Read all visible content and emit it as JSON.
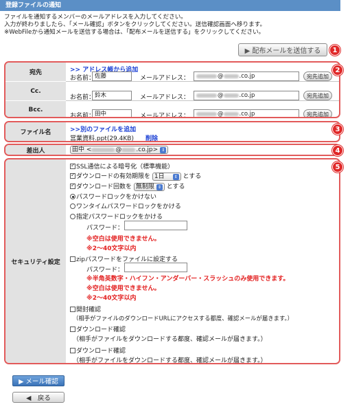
{
  "header": {
    "title": "登録ファイルの通知"
  },
  "intro": {
    "line1": "ファイルを通知するメンバーのメールアドレスを入力してください。",
    "line2": "入力が終わりましたら、「メール確認」ボタンをクリックしてください。送信確認画面へ移ります。",
    "line3": "※WebFileから通知メールを送信する場合は、「配布メールを送信する」をクリックしてください。"
  },
  "send_button": {
    "label": "▶ 配布メールを送信する"
  },
  "badges": [
    "1",
    "2",
    "3",
    "4",
    "5"
  ],
  "recipients": {
    "add_from_address_book": ">> アドレス帳から追加",
    "name_label": "お名前：",
    "mail_label": "メールアドレス：",
    "add_label": "宛先追加",
    "rows": [
      {
        "label": "宛先",
        "name": "佐藤",
        "domain": "co.jp"
      },
      {
        "label": "Cc.",
        "name": "鈴木",
        "domain": "co.jp"
      },
      {
        "label": "Bcc.",
        "name": "田中",
        "domain": "co.jp"
      }
    ]
  },
  "file": {
    "label": "ファイル名",
    "add_link": ">>別のファイルを追加",
    "filename": "営業資料.ppt(29.4KB)",
    "delete": "削除"
  },
  "sender": {
    "label": "差出人",
    "value_prefix": "田中 <",
    "value_suffix": ".co.jp>"
  },
  "security": {
    "label": "セキュリティ設定",
    "ssl": "SSL通信による暗号化（標準機能）",
    "expiry_prefix": "ダウンロードの有効期限を",
    "expiry_value": "1日",
    "expiry_suffix": "とする",
    "count_prefix": "ダウンロード回数を",
    "count_value": "無制限",
    "count_suffix": "とする",
    "radio_none": "パスワードロックをかけない",
    "radio_onetime": "ワンタイムパスワードロックをかける",
    "radio_fixed": "指定パスワードロックをかける",
    "password_label": "パスワード：",
    "note_blank": "※空白は使用できません。",
    "note_length": "※2～40文字以内",
    "zip": "zipパスワードをファイルに設定する",
    "zip_password_label": "パスワード：",
    "zip_note_chars": "※半角英数字・ハイフン・アンダーバー・スラッシュのみ使用できます。",
    "zip_note_blank": "※空白は使用できません。",
    "zip_note_length": "※2～40文字以内",
    "open_confirm": "開封確認",
    "open_confirm_desc": "（相手がファイルのダウンロードURLにアクセスする都度、確認メールが届きます。）",
    "dl_confirm1": "ダウンロード確認",
    "dl_confirm1_desc": "（相手がファイルをダウンロードする都度、確認メールが届きます。）",
    "dl_confirm2": "ダウンロード確認",
    "dl_confirm2_desc": "（相手がファイルをダウンロードする都度、確認メールが届きます。）"
  },
  "mail_confirm_button": {
    "label": "▶ メール確認"
  },
  "back_button": {
    "label": "◀　戻る"
  }
}
